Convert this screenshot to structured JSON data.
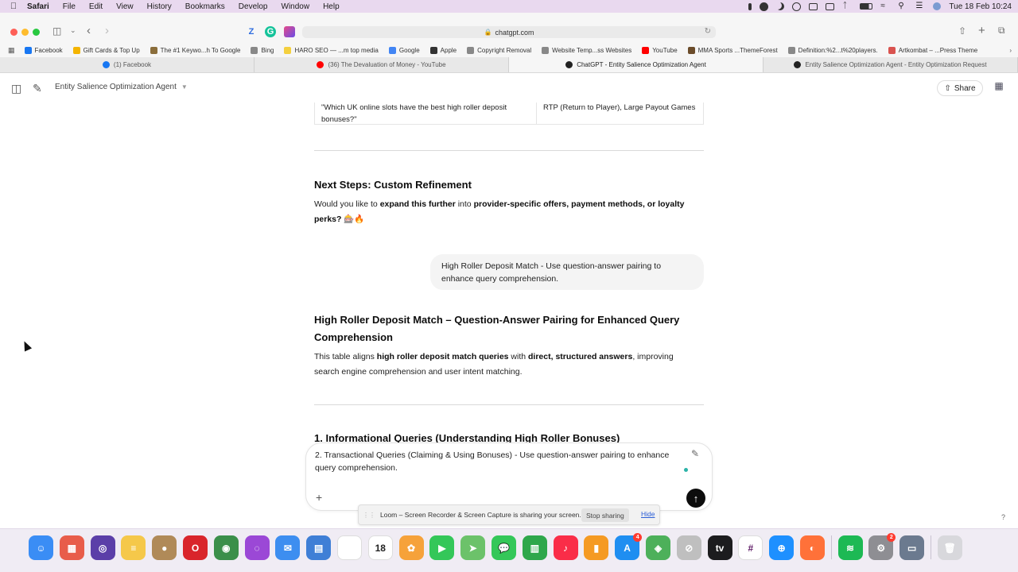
{
  "menubar": {
    "apple_icon": "apple-logo",
    "items": [
      "Safari",
      "File",
      "Edit",
      "View",
      "History",
      "Bookmarks",
      "Develop",
      "Window",
      "Help"
    ],
    "datetime": "Tue 18 Feb  10:24"
  },
  "toolbar": {
    "url": "chatgpt.com",
    "extensions": [
      "Z",
      "G"
    ]
  },
  "bookmarks": [
    {
      "label": "Facebook",
      "color": "#1877f2"
    },
    {
      "label": "Gift Cards & Top Up",
      "color": "#f4b400"
    },
    {
      "label": "The #1 Keywo...h To Google",
      "color": "#8a6d3b"
    },
    {
      "label": "Bing",
      "color": "#888888"
    },
    {
      "label": "HARO SEO — ...m top media",
      "color": "#f4d03f"
    },
    {
      "label": "Google",
      "color": "#4285f4"
    },
    {
      "label": "Apple",
      "color": "#333333"
    },
    {
      "label": "Copyright Removal",
      "color": "#888888"
    },
    {
      "label": "Website Temp...ss Websites",
      "color": "#888888"
    },
    {
      "label": "YouTube",
      "color": "#ff0000"
    },
    {
      "label": "MMA Sports ...ThemeForest",
      "color": "#6b4c2a"
    },
    {
      "label": "Definition:%2...t%20players.",
      "color": "#888888"
    },
    {
      "label": "Artkombat – ...Press Theme",
      "color": "#d9534f"
    }
  ],
  "tabs": [
    {
      "label": "(1) Facebook",
      "color": "#1877f2",
      "active": false
    },
    {
      "label": "(36) The Devaluation of Money - YouTube",
      "color": "#ff0000",
      "active": false
    },
    {
      "label": "ChatGPT - Entity Salience Optimization Agent",
      "color": "#222222",
      "active": true
    },
    {
      "label": "Entity Salience Optimization Agent - Entity Optimization Request",
      "color": "#222222",
      "active": false
    }
  ],
  "header": {
    "model_name": "Entity Salience Optimization Agent",
    "share_label": "Share"
  },
  "conversation": {
    "table_fragment": {
      "col1": "\"Which UK online slots have the best high roller deposit bonuses?\"",
      "col2": "RTP (Return to Player), Large Payout Games"
    },
    "next_steps_heading": "Next Steps: Custom Refinement",
    "next_steps_para": {
      "p1": "Would you like to ",
      "b1": "expand this further",
      "p2": " into ",
      "b2": "provider-specific offers, payment methods, or loyalty perks?",
      "emoji": "🎰🔥"
    },
    "user_message": "High Roller Deposit Match - Use question-answer pairing to enhance query comprehension.",
    "response_heading": "High Roller Deposit Match – Question-Answer Pairing for Enhanced Query Comprehension",
    "response_para": {
      "p1": "This table aligns ",
      "b1": "high roller deposit match queries",
      "p2": " with ",
      "b2": "direct, structured answers",
      "p3": ", improving search engine comprehension and user intent matching."
    },
    "section_heading": "1. Informational Queries (Understanding High Roller Bonuses)"
  },
  "composer": {
    "text": "2. Transactional Queries (Claiming & Using Bonuses) - Use question-answer pairing to enhance query comprehension."
  },
  "loom": {
    "message": "Loom – Screen Recorder & Screen Capture is sharing your screen.",
    "stop_label": "Stop sharing",
    "hide_label": "Hide"
  },
  "help_label": "?",
  "dock": [
    {
      "name": "finder",
      "color": "#3a8df5",
      "glyph": "☺"
    },
    {
      "name": "launchpad",
      "color": "#e85d4a",
      "glyph": "▦"
    },
    {
      "name": "siri",
      "color": "#5b3fa8",
      "glyph": "◎"
    },
    {
      "name": "notes",
      "color": "#f5c84a",
      "glyph": "≡"
    },
    {
      "name": "contacts",
      "color": "#b08a58",
      "glyph": "●"
    },
    {
      "name": "opera",
      "color": "#d9252b",
      "glyph": "O"
    },
    {
      "name": "chrome",
      "color": "#3b8f4a",
      "glyph": "◉"
    },
    {
      "name": "podcasts",
      "color": "#9b48d6",
      "glyph": "◌"
    },
    {
      "name": "mail",
      "color": "#3d8ef0",
      "glyph": "✉"
    },
    {
      "name": "keynote",
      "color": "#3f7fd6",
      "glyph": "▤"
    },
    {
      "name": "reminders",
      "color": "#ffffff",
      "glyph": "☰"
    },
    {
      "name": "calendar",
      "color": "#ffffff",
      "glyph": "18",
      "text_color": "#222222"
    },
    {
      "name": "photos",
      "color": "#f6a23a",
      "glyph": "✿"
    },
    {
      "name": "facetime",
      "color": "#34c759",
      "glyph": "▶"
    },
    {
      "name": "maps",
      "color": "#6cc26a",
      "glyph": "➤"
    },
    {
      "name": "messages",
      "color": "#34c759",
      "glyph": "💬"
    },
    {
      "name": "numbers",
      "color": "#2fa74b",
      "glyph": "▥"
    },
    {
      "name": "music",
      "color": "#fa2d48",
      "glyph": "♪"
    },
    {
      "name": "books",
      "color": "#f59a23",
      "glyph": "▮"
    },
    {
      "name": "app-store",
      "color": "#1f8ef1",
      "glyph": "A",
      "badge": "4"
    },
    {
      "name": "maps-2",
      "color": "#4db05a",
      "glyph": "◈"
    },
    {
      "name": "disabled-app",
      "color": "#bfbfbf",
      "glyph": "⊘"
    },
    {
      "name": "apple-tv",
      "color": "#1c1c1e",
      "glyph": "tv"
    },
    {
      "name": "slack",
      "color": "#ffffff",
      "glyph": "#",
      "text_color": "#611f69"
    },
    {
      "name": "safari",
      "color": "#1e90ff",
      "glyph": "⊕"
    },
    {
      "name": "firefox",
      "color": "#ff7139",
      "glyph": "◐"
    },
    {
      "name": "spotify",
      "color": "#1db954",
      "glyph": "≋"
    },
    {
      "name": "system-settings",
      "color": "#8e8e93",
      "glyph": "⚙",
      "badge": "2"
    },
    {
      "name": "screen-recorder",
      "color": "#6b7a8f",
      "glyph": "▭"
    },
    {
      "name": "trash",
      "color": "#d8d8dc",
      "glyph": "🗑"
    }
  ]
}
